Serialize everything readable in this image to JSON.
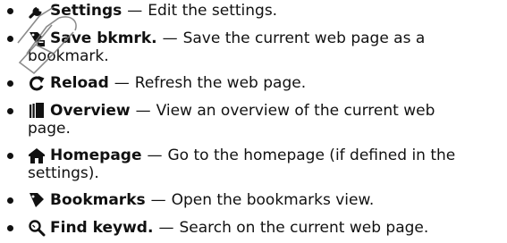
{
  "items": [
    {
      "icon": "wrench-icon",
      "title": "Settings",
      "dash": "—",
      "desc": "Edit the settings.",
      "desc2": ""
    },
    {
      "icon": "bookmark-add-icon",
      "title": "Save bkmrk.",
      "dash": "—",
      "desc": "Save the current web page as a",
      "desc2": "bookmark."
    },
    {
      "icon": "reload-icon",
      "title": "Reload",
      "dash": "—",
      "desc": "Refresh the web page.",
      "desc2": ""
    },
    {
      "icon": "overview-icon",
      "title": "Overview",
      "dash": "—",
      "desc": "View an overview of the current web",
      "desc2": "page."
    },
    {
      "icon": "home-icon",
      "title": "Homepage",
      "dash": "—",
      "desc": "Go to the homepage (if defined in the",
      "desc2": "settings)."
    },
    {
      "icon": "bookmarks-icon",
      "title": "Bookmarks",
      "dash": "—",
      "desc": "Open the bookmarks view.",
      "desc2": ""
    },
    {
      "icon": "find-icon",
      "title": "Find keywd.",
      "dash": "—",
      "desc": "Search on the current web page.",
      "desc2": ""
    }
  ],
  "colors": {
    "text": "#111111",
    "watermark": "#777777"
  }
}
